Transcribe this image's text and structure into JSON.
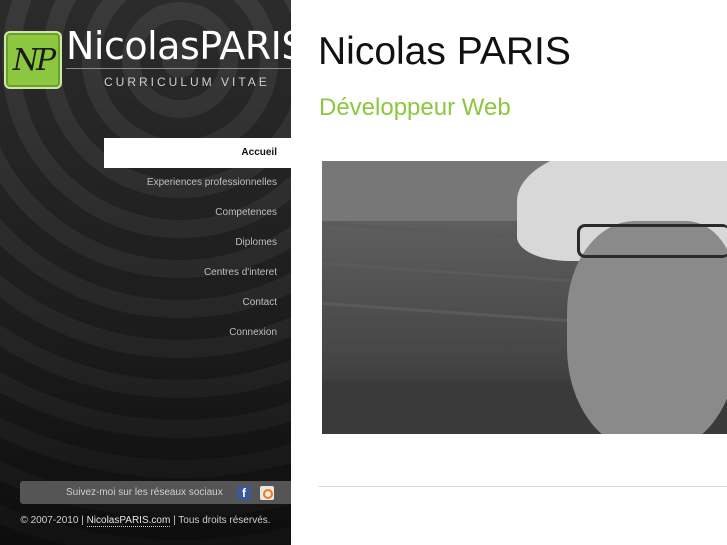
{
  "brand": {
    "logo_text": "NP",
    "title": "NicolasPARIS",
    "subtitle": "CURRICULUM VITAE"
  },
  "nav": {
    "items": [
      {
        "label": "Accueil",
        "active": true
      },
      {
        "label": "Experiences professionnelles"
      },
      {
        "label": "Competences"
      },
      {
        "label": "Diplomes"
      },
      {
        "label": "Centres d'interet"
      },
      {
        "label": "Contact"
      },
      {
        "label": "Connexion"
      }
    ]
  },
  "social": {
    "label": "Suivez-moi sur les réseaux sociaux",
    "icons": [
      "facebook-icon",
      "rss-icon"
    ]
  },
  "footer": {
    "prefix": "© 2007-2010 | ",
    "link": "NicolasPARIS.com",
    "suffix": " | Tous droits réservés."
  },
  "main": {
    "title": "Nicolas PARIS",
    "subtitle": "Développeur Web",
    "photo_alt": "portrait"
  },
  "colors": {
    "accent": "#8dc63f",
    "sidebar_bg": "#222222"
  }
}
